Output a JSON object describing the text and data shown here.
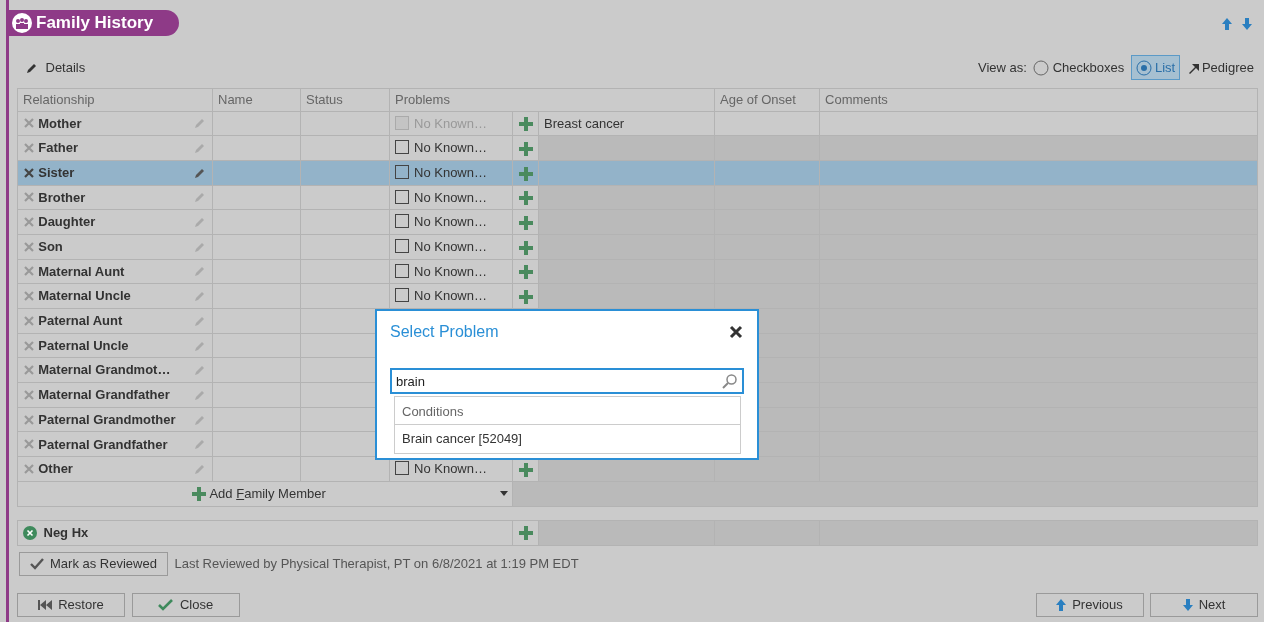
{
  "header": {
    "title": "Family History"
  },
  "toolbar": {
    "details": "Details",
    "view_as": "View as:",
    "views": [
      {
        "label": "Checkboxes",
        "kind": "radio",
        "selected": false
      },
      {
        "label": "List",
        "kind": "radio",
        "selected": true
      },
      {
        "label": "Pedigree",
        "kind": "link",
        "selected": false
      }
    ]
  },
  "table": {
    "columns": [
      "Relationship",
      "Name",
      "Status",
      "Problems",
      "Age of Onset",
      "Comments"
    ],
    "rows": [
      {
        "relationship": "Mother",
        "selected": false,
        "no_known": {
          "label": "No Known…",
          "checked": false,
          "disabled": true
        },
        "problem": "Breast cancer"
      },
      {
        "relationship": "Father",
        "selected": false,
        "no_known": {
          "label": "No Known…",
          "checked": false,
          "disabled": false
        }
      },
      {
        "relationship": "Sister",
        "selected": true,
        "no_known": {
          "label": "No Known…",
          "checked": false,
          "disabled": false
        }
      },
      {
        "relationship": "Brother",
        "selected": false,
        "no_known": {
          "label": "No Known…",
          "checked": false,
          "disabled": false
        }
      },
      {
        "relationship": "Daughter",
        "selected": false,
        "no_known": {
          "label": "No Known…",
          "checked": false,
          "disabled": false
        }
      },
      {
        "relationship": "Son",
        "selected": false,
        "no_known": {
          "label": "No Known…",
          "checked": false,
          "disabled": false
        }
      },
      {
        "relationship": "Maternal Aunt",
        "selected": false,
        "no_known": {
          "label": "No Known…",
          "checked": false,
          "disabled": false
        }
      },
      {
        "relationship": "Maternal Uncle",
        "selected": false,
        "no_known": {
          "label": "No Known…",
          "checked": false,
          "disabled": false
        }
      },
      {
        "relationship": "Paternal Aunt",
        "selected": false
      },
      {
        "relationship": "Paternal Uncle",
        "selected": false
      },
      {
        "relationship": "Maternal Grandmot…",
        "selected": false
      },
      {
        "relationship": "Maternal Grandfather",
        "selected": false
      },
      {
        "relationship": "Paternal Grandmother",
        "selected": false
      },
      {
        "relationship": "Paternal Grandfather",
        "selected": false
      },
      {
        "relationship": "Other",
        "selected": false,
        "no_known": {
          "label": "No Known…",
          "checked": false,
          "disabled": false
        }
      }
    ],
    "add_member": "Add **F**amily Member"
  },
  "neg_hx": "Neg Hx",
  "review": {
    "button": "Mark as Reviewed",
    "note": "Last Reviewed by Physical Therapist, PT on 6/8/2021 at 1:19 PM EDT"
  },
  "footer": {
    "left": [
      "Restore",
      "Close"
    ],
    "right": [
      "Previous",
      "Next"
    ]
  },
  "dialog": {
    "title": "Select Problem",
    "search_value": "brain",
    "group": "Conditions",
    "results": [
      "Brain cancer [52049]"
    ]
  }
}
